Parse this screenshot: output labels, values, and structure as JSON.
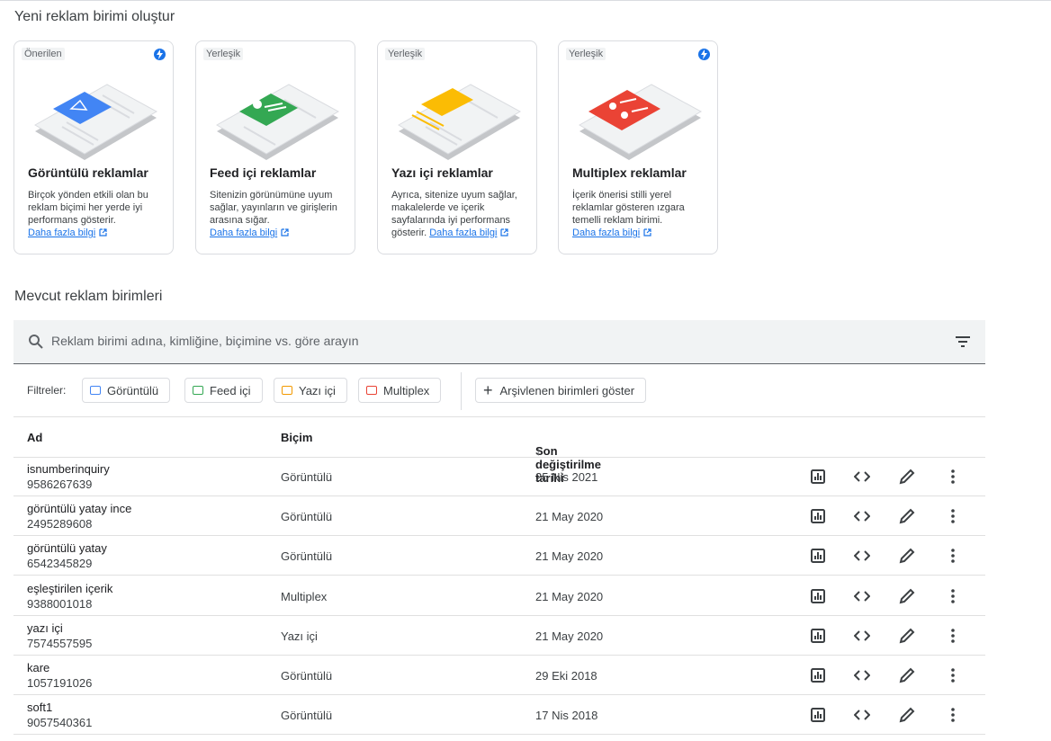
{
  "create_section": {
    "title": "Yeni reklam birimi oluştur",
    "cards": [
      {
        "tag": "Önerilen",
        "title": "Görüntülü reklamlar",
        "desc": "Birçok yönden etkili olan bu reklam biçimi her yerde iyi performans gösterir.",
        "link": "Daha fazla bilgi",
        "color": "#4285f4",
        "bolt": true
      },
      {
        "tag": "Yerleşik",
        "title": "Feed içi reklamlar",
        "desc": "Sitenizin görünümüne uyum sağlar, yayınların ve girişlerin arasına sığar.",
        "link": "Daha fazla bilgi",
        "color": "#34a853",
        "bolt": false
      },
      {
        "tag": "Yerleşik",
        "title": "Yazı içi reklamlar",
        "desc": "Ayrıca, sitenize uyum sağlar, makalelerde ve içerik sayfalarında iyi performans gösterir.",
        "link": "Daha fazla bilgi",
        "color": "#fbbc04",
        "bolt": false
      },
      {
        "tag": "Yerleşik",
        "title": "Multiplex reklamlar",
        "desc": "İçerik önerisi stilli yerel reklamlar gösteren ızgara temelli reklam birimi.",
        "link": "Daha fazla bilgi",
        "color": "#ea4335",
        "bolt": true
      }
    ]
  },
  "existing_section": {
    "title": "Mevcut reklam birimleri",
    "search_placeholder": "Reklam birimi adına, kimliğine, biçimine vs. göre arayın",
    "filters_label": "Filtreler:",
    "filters": [
      {
        "label": "Görüntülü",
        "color": "#4285f4"
      },
      {
        "label": "Feed içi",
        "color": "#34a853"
      },
      {
        "label": "Yazı içi",
        "color": "#f29900"
      },
      {
        "label": "Multiplex",
        "color": "#ea4335"
      }
    ],
    "archive_button": "Arşivlenen birimleri göster",
    "columns": {
      "name": "Ad",
      "format": "Biçim",
      "modified": "Son değiştirilme tarihi"
    },
    "rows": [
      {
        "name": "isnumberinquiry",
        "id": "9586267639",
        "format": "Görüntülü",
        "date": "25 Nis 2021"
      },
      {
        "name": "görüntülü yatay ince",
        "id": "2495289608",
        "format": "Görüntülü",
        "date": "21 May 2020"
      },
      {
        "name": "görüntülü yatay",
        "id": "6542345829",
        "format": "Görüntülü",
        "date": "21 May 2020"
      },
      {
        "name": "eşleştirilen içerik",
        "id": "9388001018",
        "format": "Multiplex",
        "date": "21 May 2020"
      },
      {
        "name": "yazı içi",
        "id": "7574557595",
        "format": "Yazı içi",
        "date": "21 May 2020"
      },
      {
        "name": "kare",
        "id": "1057191026",
        "format": "Görüntülü",
        "date": "29 Eki 2018"
      },
      {
        "name": "soft1",
        "id": "9057540361",
        "format": "Görüntülü",
        "date": "17 Nis 2018"
      }
    ],
    "row_actions": [
      "report-icon",
      "code-icon",
      "edit-icon",
      "more-vert-icon"
    ]
  }
}
